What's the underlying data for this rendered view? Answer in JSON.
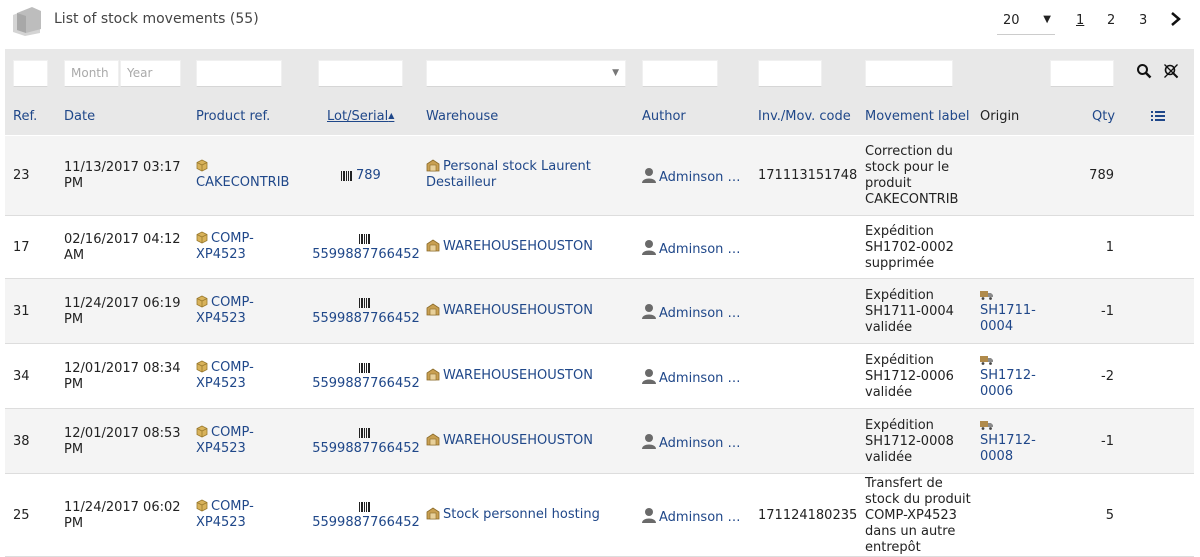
{
  "header": {
    "title": "List of stock movements (55)",
    "limit": "20",
    "pages": [
      "1",
      "2",
      "3"
    ]
  },
  "filters": {
    "month_placeholder": "Month",
    "year_placeholder": "Year"
  },
  "columns": {
    "ref": "Ref.",
    "date": "Date",
    "product": "Product ref.",
    "lot": "Lot/Serial",
    "warehouse": "Warehouse",
    "author": "Author",
    "code": "Inv./Mov. code",
    "label": "Movement label",
    "origin": "Origin",
    "qty": "Qty"
  },
  "rows": [
    {
      "ref": "23",
      "date": [
        "11/13/2017 03:17",
        "PM"
      ],
      "product": [
        "",
        "CAKECONTRIB"
      ],
      "lot": "789",
      "warehouse": [
        "Personal stock Laurent",
        "Destailleur"
      ],
      "author": "Adminson …",
      "code": "171113151748",
      "label": [
        "Correction du",
        "stock pour le",
        "produit",
        "CAKECONTRIB"
      ],
      "origin": [
        "",
        ""
      ],
      "qty": "789"
    },
    {
      "ref": "17",
      "date": [
        "02/16/2017 04:12",
        "AM"
      ],
      "product": [
        "COMP-",
        "XP4523"
      ],
      "lot": "5599887766452",
      "warehouse": [
        "WAREHOUSEHOUSTON",
        ""
      ],
      "author": "Adminson …",
      "code": "",
      "label": [
        "Expédition",
        "SH1702-0002",
        "supprimée",
        ""
      ],
      "origin": [
        "",
        ""
      ],
      "qty": "1"
    },
    {
      "ref": "31",
      "date": [
        "11/24/2017 06:19",
        "PM"
      ],
      "product": [
        "COMP-",
        "XP4523"
      ],
      "lot": "5599887766452",
      "warehouse": [
        "WAREHOUSEHOUSTON",
        ""
      ],
      "author": "Adminson …",
      "code": "",
      "label": [
        "Expédition",
        "SH1711-0004",
        "validée",
        ""
      ],
      "origin": [
        "SH1711-",
        "0004"
      ],
      "qty": "-1"
    },
    {
      "ref": "34",
      "date": [
        "12/01/2017 08:34",
        "PM"
      ],
      "product": [
        "COMP-",
        "XP4523"
      ],
      "lot": "5599887766452",
      "warehouse": [
        "WAREHOUSEHOUSTON",
        ""
      ],
      "author": "Adminson …",
      "code": "",
      "label": [
        "Expédition",
        "SH1712-0006",
        "validée",
        ""
      ],
      "origin": [
        "SH1712-",
        "0006"
      ],
      "qty": "-2"
    },
    {
      "ref": "38",
      "date": [
        "12/01/2017 08:53",
        "PM"
      ],
      "product": [
        "COMP-",
        "XP4523"
      ],
      "lot": "5599887766452",
      "warehouse": [
        "WAREHOUSEHOUSTON",
        ""
      ],
      "author": "Adminson …",
      "code": "",
      "label": [
        "Expédition",
        "SH1712-0008",
        "validée",
        ""
      ],
      "origin": [
        "SH1712-",
        "0008"
      ],
      "qty": "-1"
    },
    {
      "ref": "25",
      "date": [
        "11/24/2017 06:02",
        "PM"
      ],
      "product": [
        "COMP-",
        "XP4523"
      ],
      "lot": "5599887766452",
      "warehouse": [
        "Stock personnel hosting",
        ""
      ],
      "author": "Adminson …",
      "code": "171124180235",
      "label": [
        "Transfert de",
        "stock du produit",
        "COMP-XP4523",
        "dans un autre",
        "entrepôt"
      ],
      "origin": [
        "",
        ""
      ],
      "qty": "5"
    }
  ],
  "icons": {
    "list": "stock-movement-list-icon",
    "product": "product-box-icon",
    "lot": "barcode-icon",
    "warehouse": "warehouse-icon",
    "author": "user-icon",
    "origin": "shipment-truck-icon",
    "search": "search-icon",
    "clear": "clear-filter-icon",
    "columns": "column-list-icon",
    "next": "chevron-right-icon"
  },
  "colors": {
    "link": "#1f4789",
    "filter_bg": "#e8e8e8",
    "row_alt": "#f4f4f4"
  }
}
